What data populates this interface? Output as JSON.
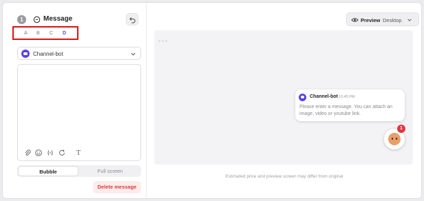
{
  "editor": {
    "step": "1",
    "title": "Message",
    "variants": [
      "A",
      "B",
      "C",
      "D"
    ],
    "active_variant": "D",
    "sender": "Channel-bot",
    "toolbar_text_tool": "T",
    "tabs": [
      "Bubble",
      "Full screen"
    ],
    "active_tab": "Bubble",
    "delete_label": "Delete message"
  },
  "preview": {
    "label": "Preview",
    "device": "Desktop",
    "bubble": {
      "sender": "Channel-bot",
      "time": "10:45 PM",
      "text": "Please enter a message. You can attach an image, video or youtube link."
    },
    "badge_count": "1",
    "disclaimer": "Estimated price and preview screen may differ from original"
  },
  "colors": {
    "accent": "#5b3fe6",
    "danger": "#e0383e",
    "highlight_box": "#e01010"
  }
}
